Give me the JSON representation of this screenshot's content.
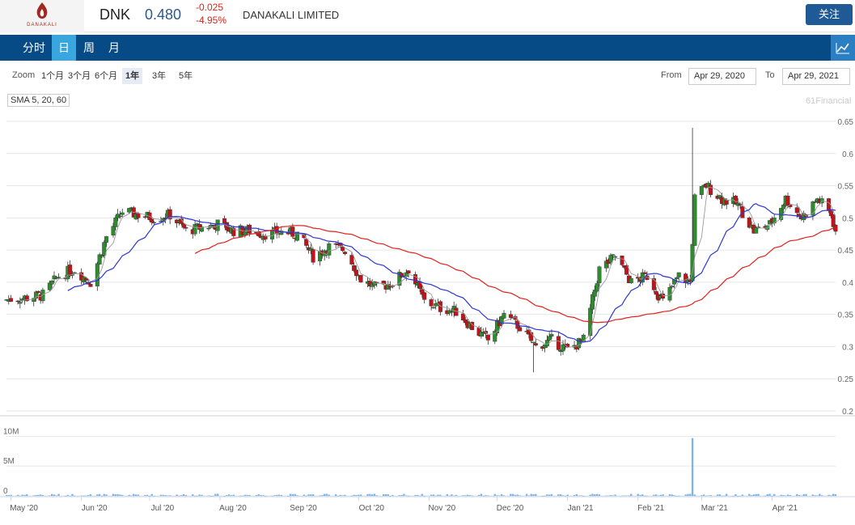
{
  "header": {
    "logo_text": "DANAKALI",
    "ticker": "DNK",
    "price": "0.480",
    "change": "-0.025",
    "change_pct": "-4.95%",
    "company": "DANAKALI LIMITED",
    "follow_label": "关注"
  },
  "tabs": [
    {
      "label": "分时",
      "active": false
    },
    {
      "label": "日",
      "active": true
    },
    {
      "label": "周",
      "active": false
    },
    {
      "label": "月",
      "active": false
    }
  ],
  "chart_icon": "line-chart-icon",
  "toolbar": {
    "zoom_label": "Zoom",
    "zoom_options": [
      "1个月",
      "3个月",
      "6个月",
      "1年",
      "3年",
      "5年"
    ],
    "zoom_selected": "1年",
    "from_label": "From",
    "from_value": "Apr 29, 2020",
    "to_label": "To",
    "to_value": "Apr 29, 2021"
  },
  "indicator_label": "SMA 5, 20, 60",
  "credit": "61Financial",
  "colors": {
    "up": "#2e8b2e",
    "down": "#c0141a",
    "sma5": "#9a9a9a",
    "sma20": "#2b35d6",
    "sma60": "#e0201a",
    "volume": "#7cb5ec",
    "accent": "#064a86"
  },
  "chart_data": {
    "type": "candlestick",
    "price_axis": {
      "min": 0.2,
      "max": 0.65,
      "ticks": [
        0.65,
        0.6,
        0.55,
        0.5,
        0.45,
        0.4,
        0.35,
        0.3,
        0.25,
        0.2
      ],
      "tick_labels": [
        "0.65",
        "0.6",
        "0.55",
        "0.5",
        "0.45",
        "0.4",
        "0.35",
        "0.3",
        "0.25",
        "0.2"
      ]
    },
    "volume_axis": {
      "max": 11000000,
      "ticks": [
        0,
        5000000,
        10000000
      ],
      "tick_labels": [
        "0",
        "5M",
        "10M"
      ]
    },
    "x_range": [
      "2020-04-29",
      "2021-04-29"
    ],
    "x_ticks": [
      {
        "date": "2020-05-01",
        "label": "May '20"
      },
      {
        "date": "2020-06-01",
        "label": "Jun '20"
      },
      {
        "date": "2020-07-01",
        "label": "Jul '20"
      },
      {
        "date": "2020-08-01",
        "label": "Aug '20"
      },
      {
        "date": "2020-09-01",
        "label": "Sep '20"
      },
      {
        "date": "2020-10-01",
        "label": "Oct '20"
      },
      {
        "date": "2020-11-01",
        "label": "Nov '20"
      },
      {
        "date": "2020-12-01",
        "label": "Dec '20"
      },
      {
        "date": "2021-01-01",
        "label": "Jan '21"
      },
      {
        "date": "2021-02-01",
        "label": "Feb '21"
      },
      {
        "date": "2021-03-01",
        "label": "Mar '21"
      },
      {
        "date": "2021-04-01",
        "label": "Apr '21"
      }
    ],
    "close_anchors": [
      [
        "2020-04-29",
        0.373
      ],
      [
        "2020-05-08",
        0.376
      ],
      [
        "2020-05-15",
        0.38
      ],
      [
        "2020-05-22",
        0.41
      ],
      [
        "2020-05-29",
        0.42
      ],
      [
        "2020-06-05",
        0.4
      ],
      [
        "2020-06-12",
        0.47
      ],
      [
        "2020-06-19",
        0.51
      ],
      [
        "2020-06-26",
        0.505
      ],
      [
        "2020-07-03",
        0.5
      ],
      [
        "2020-07-10",
        0.505
      ],
      [
        "2020-07-17",
        0.48
      ],
      [
        "2020-07-24",
        0.485
      ],
      [
        "2020-07-31",
        0.49
      ],
      [
        "2020-08-07",
        0.48
      ],
      [
        "2020-08-14",
        0.48
      ],
      [
        "2020-08-21",
        0.475
      ],
      [
        "2020-08-28",
        0.478
      ],
      [
        "2020-09-04",
        0.475
      ],
      [
        "2020-09-11",
        0.44
      ],
      [
        "2020-09-18",
        0.455
      ],
      [
        "2020-09-25",
        0.45
      ],
      [
        "2020-10-02",
        0.405
      ],
      [
        "2020-10-09",
        0.39
      ],
      [
        "2020-10-16",
        0.4
      ],
      [
        "2020-10-23",
        0.42
      ],
      [
        "2020-10-30",
        0.37
      ],
      [
        "2020-11-06",
        0.36
      ],
      [
        "2020-11-13",
        0.355
      ],
      [
        "2020-11-20",
        0.33
      ],
      [
        "2020-11-27",
        0.31
      ],
      [
        "2020-12-04",
        0.35
      ],
      [
        "2020-12-11",
        0.33
      ],
      [
        "2020-12-18",
        0.3
      ],
      [
        "2020-12-25",
        0.31
      ],
      [
        "2021-01-01",
        0.295
      ],
      [
        "2021-01-08",
        0.31
      ],
      [
        "2021-01-15",
        0.42
      ],
      [
        "2021-01-22",
        0.44
      ],
      [
        "2021-01-29",
        0.4
      ],
      [
        "2021-02-05",
        0.41
      ],
      [
        "2021-02-12",
        0.37
      ],
      [
        "2021-02-19",
        0.41
      ],
      [
        "2021-02-24",
        0.4
      ],
      [
        "2021-02-26",
        0.53
      ],
      [
        "2021-03-03",
        0.55
      ],
      [
        "2021-03-10",
        0.53
      ],
      [
        "2021-03-17",
        0.52
      ],
      [
        "2021-03-24",
        0.48
      ],
      [
        "2021-03-31",
        0.49
      ],
      [
        "2021-04-07",
        0.53
      ],
      [
        "2021-04-14",
        0.5
      ],
      [
        "2021-04-21",
        0.53
      ],
      [
        "2021-04-27",
        0.505
      ],
      [
        "2021-04-29",
        0.48
      ]
    ],
    "notable_high": {
      "date": "2021-02-25",
      "value": 0.64
    },
    "notable_low": {
      "date": "2020-12-17",
      "value": 0.26
    },
    "notable_volume": {
      "date": "2021-02-25",
      "value": 9700000
    },
    "series": [
      {
        "name": "SMA 5"
      },
      {
        "name": "SMA 20"
      },
      {
        "name": "SMA 60"
      }
    ]
  }
}
